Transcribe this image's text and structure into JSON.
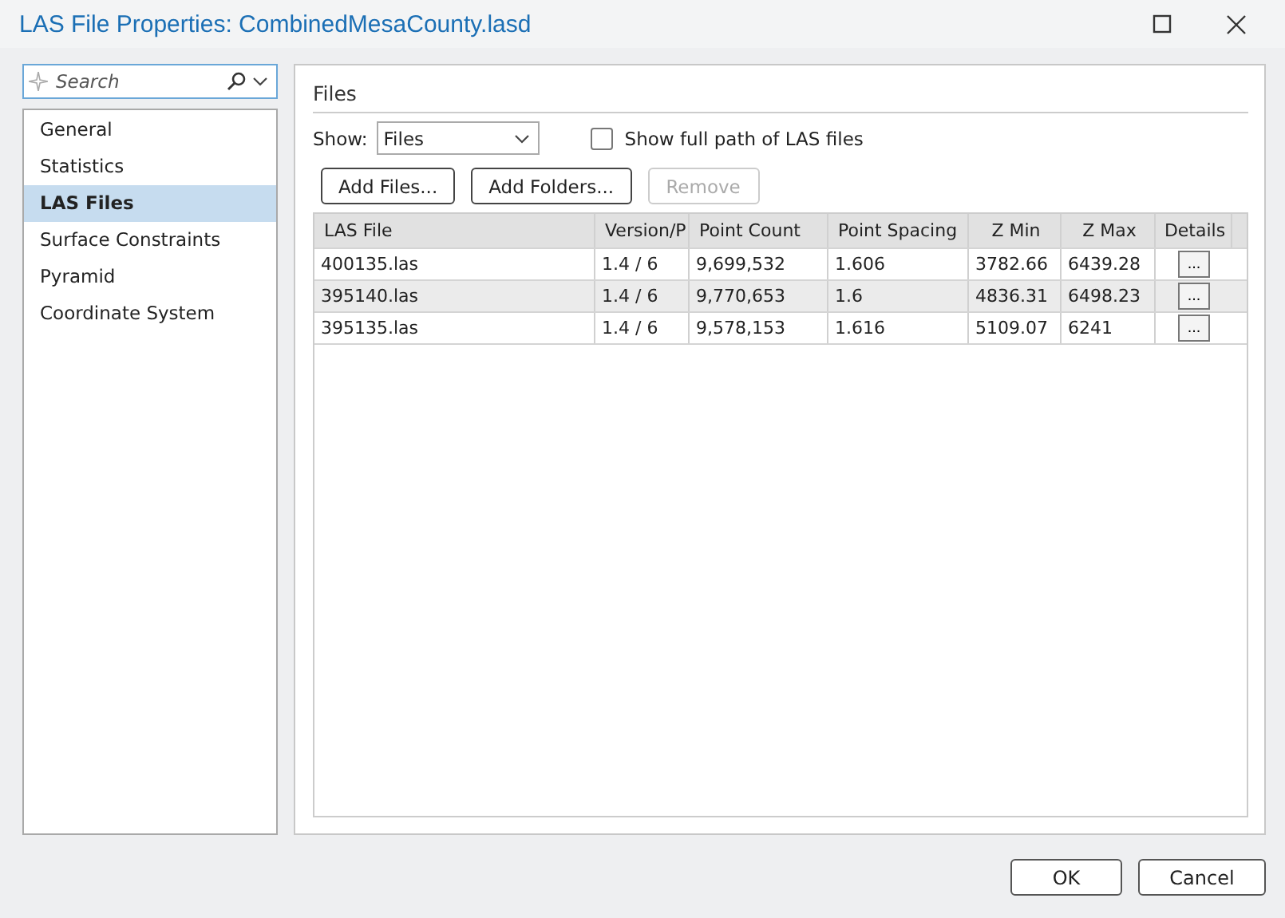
{
  "window": {
    "title": "LAS File Properties: CombinedMesaCounty.lasd"
  },
  "sidebar": {
    "search": {
      "placeholder": "Search"
    },
    "items": [
      {
        "label": "General",
        "selected": false
      },
      {
        "label": "Statistics",
        "selected": false
      },
      {
        "label": "LAS Files",
        "selected": true
      },
      {
        "label": "Surface Constraints",
        "selected": false
      },
      {
        "label": "Pyramid",
        "selected": false
      },
      {
        "label": "Coordinate System",
        "selected": false
      }
    ]
  },
  "panel": {
    "heading": "Files",
    "show_label": "Show:",
    "show_value": "Files",
    "full_path": {
      "label": "Show full path of LAS files",
      "checked": false
    },
    "buttons": [
      {
        "label": "Add Files...",
        "disabled": false
      },
      {
        "label": "Add Folders...",
        "disabled": false
      },
      {
        "label": "Remove",
        "disabled": true
      }
    ],
    "table": {
      "columns": [
        "LAS File",
        "Version/P",
        "Point Count",
        "Point Spacing",
        "Z Min",
        "Z Max",
        "Details"
      ],
      "rows": [
        {
          "cells": [
            "400135.las",
            "1.4 / 6",
            "9,699,532",
            "1.606",
            "3782.66",
            "6439.28"
          ],
          "details": "..."
        },
        {
          "cells": [
            "395140.las",
            "1.4 / 6",
            "9,770,653",
            "1.6",
            "4836.31",
            "6498.23"
          ],
          "details": "..."
        },
        {
          "cells": [
            "395135.las",
            "1.4 / 6",
            "9,578,153",
            "1.616",
            "5109.07",
            "6241"
          ],
          "details": "..."
        }
      ]
    }
  },
  "footer": {
    "buttons": [
      "OK",
      "Cancel"
    ]
  }
}
